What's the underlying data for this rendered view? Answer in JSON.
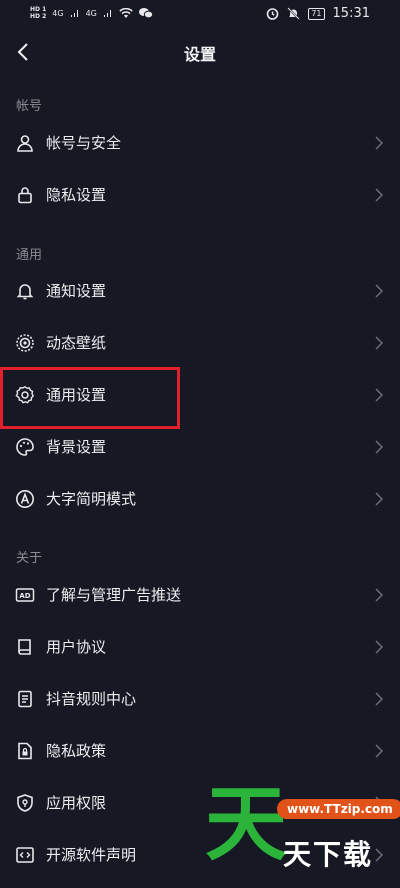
{
  "status": {
    "sim1": "HD 1",
    "sim2": "HD 2",
    "net1": "4G",
    "net2": "4G",
    "battery": "71",
    "time": "15:31"
  },
  "nav": {
    "title": "设置"
  },
  "sections": {
    "account": "帐号",
    "general": "通用",
    "about": "关于"
  },
  "rows": [
    {
      "label": "帐号与安全",
      "icon": "user-icon"
    },
    {
      "label": "隐私设置",
      "icon": "lock-icon"
    },
    {
      "label": "通知设置",
      "icon": "bell-icon"
    },
    {
      "label": "动态壁纸",
      "icon": "wallpaper-icon"
    },
    {
      "label": "通用设置",
      "icon": "gear-icon"
    },
    {
      "label": "背景设置",
      "icon": "palette-icon"
    },
    {
      "label": "大字简明模式",
      "icon": "font-a-icon"
    },
    {
      "label": "了解与管理广告推送",
      "icon": "ad-icon"
    },
    {
      "label": "用户协议",
      "icon": "book-icon"
    },
    {
      "label": "抖音规则中心",
      "icon": "document-icon"
    },
    {
      "label": "隐私政策",
      "icon": "file-lock-icon"
    },
    {
      "label": "应用权限",
      "icon": "shield-icon"
    },
    {
      "label": "开源软件声明",
      "icon": "code-icon"
    }
  ],
  "watermark": {
    "big": "天",
    "url": "www.TTzip.com",
    "small": "天下载"
  },
  "colors": {
    "background": "#161823",
    "highlight": "#e21f2a"
  }
}
